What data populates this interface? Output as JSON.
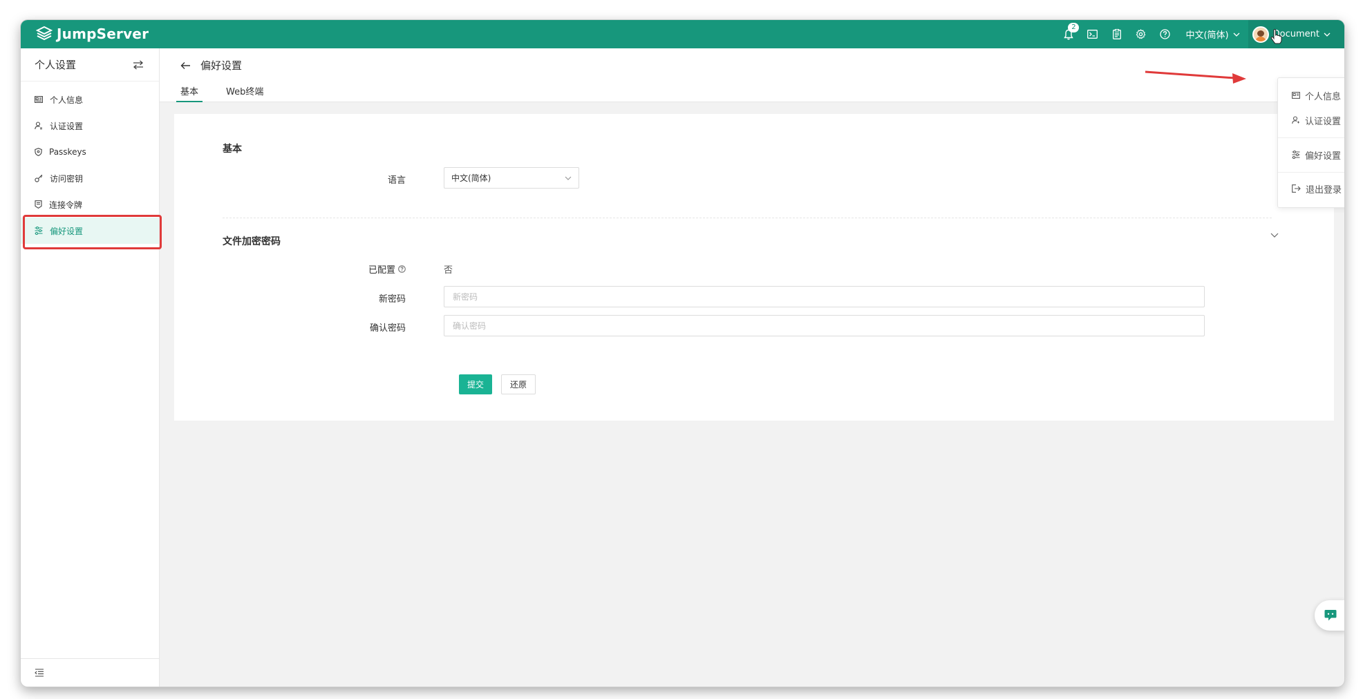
{
  "app": {
    "brand": "JumpServer"
  },
  "topbar": {
    "notification_count": "2",
    "language": "中文(简体)",
    "username": "Document"
  },
  "sidebar": {
    "title": "个人设置",
    "items": [
      {
        "label": "个人信息",
        "icon": "id-card-icon"
      },
      {
        "label": "认证设置",
        "icon": "user-shield-icon"
      },
      {
        "label": "Passkeys",
        "icon": "shield-icon"
      },
      {
        "label": "访问密钥",
        "icon": "key-icon"
      },
      {
        "label": "连接令牌",
        "icon": "token-icon"
      },
      {
        "label": "偏好设置",
        "icon": "sliders-icon"
      }
    ]
  },
  "page": {
    "title": "偏好设置",
    "tabs": [
      "基本",
      "Web终端"
    ]
  },
  "form": {
    "section_basic": "基本",
    "language_label": "语言",
    "language_value": "中文(简体)",
    "section_file_enc": "文件加密密码",
    "configured_label": "已配置",
    "configured_value": "否",
    "new_password_label": "新密码",
    "new_password_placeholder": "新密码",
    "confirm_password_label": "确认密码",
    "confirm_password_placeholder": "确认密码",
    "submit_label": "提交",
    "reset_label": "还原"
  },
  "user_menu": {
    "items": [
      "个人信息",
      "认证设置",
      "偏好设置",
      "退出登录"
    ]
  },
  "colors": {
    "brand": "#17977c",
    "primary_button": "#1ab394",
    "annotation": "#e03a3a"
  }
}
